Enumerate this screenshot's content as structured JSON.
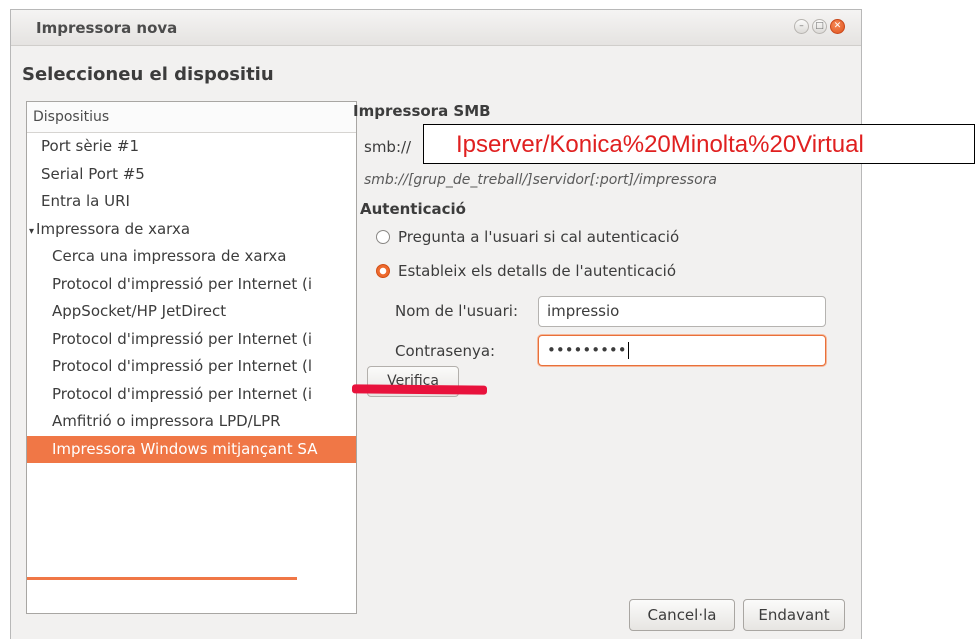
{
  "window": {
    "title": "Impressora nova",
    "heading": "Seleccioneu el dispositiu",
    "controls": {
      "minimize": "–",
      "maximize": "□",
      "close": "✕"
    }
  },
  "devices": {
    "header": "Dispositius",
    "items": [
      {
        "label": "Port sèrie #1"
      },
      {
        "label": "Serial Port #5"
      },
      {
        "label": "Entra la URI"
      },
      {
        "label": "Impressora de xarxa",
        "expander": "▾"
      },
      {
        "label": "Cerca una impressora de xarxa"
      },
      {
        "label": "Protocol d'impressió per Internet (i"
      },
      {
        "label": "AppSocket/HP JetDirect"
      },
      {
        "label": "Protocol d'impressió per Internet (i"
      },
      {
        "label": "Protocol d'impressió per Internet (l"
      },
      {
        "label": "Protocol d'impressió per Internet (i"
      },
      {
        "label": "Amfitrió o impressora LPD/LPR"
      },
      {
        "label": "Impressora Windows mitjançant SA"
      }
    ]
  },
  "smb": {
    "title": "Impressora SMB",
    "prefix": "smb://",
    "uri_value": "Ipserver/Konica%20Minolta%20Virtual",
    "hint": "smb://[grup_de_treball/]servidor[:port]/impressora"
  },
  "auth": {
    "title": "Autenticació",
    "option_ask": "Pregunta a l'usuari si cal autenticació",
    "option_set": "Estableix els detalls de l'autenticació",
    "selected": "option_set",
    "username_label": "Nom de l'usuari:",
    "username_value": "impressio",
    "password_label": "Contrasenya:",
    "password_value": "•••••••••",
    "verify_label": "Verifica"
  },
  "buttons": {
    "cancel": "Cancel·la",
    "forward": "Endavant"
  },
  "colors": {
    "accent": "#f07746",
    "redaction": "#e8123c",
    "overlay_text": "#e02020"
  }
}
